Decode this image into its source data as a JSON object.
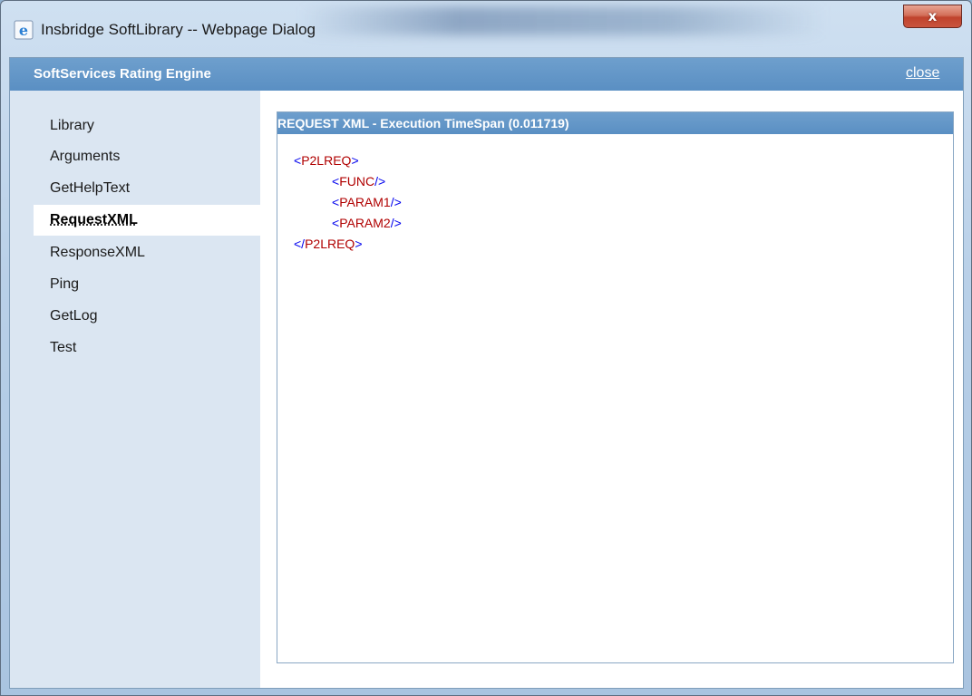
{
  "window": {
    "title": "Insbridge SoftLibrary -- Webpage Dialog",
    "close_symbol": "x",
    "icon": "ie-page-icon"
  },
  "header": {
    "title": "SoftServices Rating Engine",
    "close_link": "close"
  },
  "sidebar": {
    "items": [
      {
        "label": "Library",
        "active": false
      },
      {
        "label": "Arguments",
        "active": false
      },
      {
        "label": "GetHelpText",
        "active": false
      },
      {
        "label": "RequestXML",
        "active": true
      },
      {
        "label": "ResponseXML",
        "active": false
      },
      {
        "label": "Ping",
        "active": false
      },
      {
        "label": "GetLog",
        "active": false
      },
      {
        "label": "Test",
        "active": false
      }
    ]
  },
  "panel": {
    "title": "REQUEST XML - Execution TimeSpan (0.011719)",
    "xml": {
      "root_open": "P2LREQ",
      "children": [
        "FUNC",
        "PARAM1",
        "PARAM2"
      ],
      "root_close": "P2LREQ"
    }
  },
  "colors": {
    "header_blue": "#5a8fc3",
    "sidebar_bg": "#dbe6f2",
    "xml_bracket": "#0000ee",
    "xml_tag": "#b00000"
  }
}
